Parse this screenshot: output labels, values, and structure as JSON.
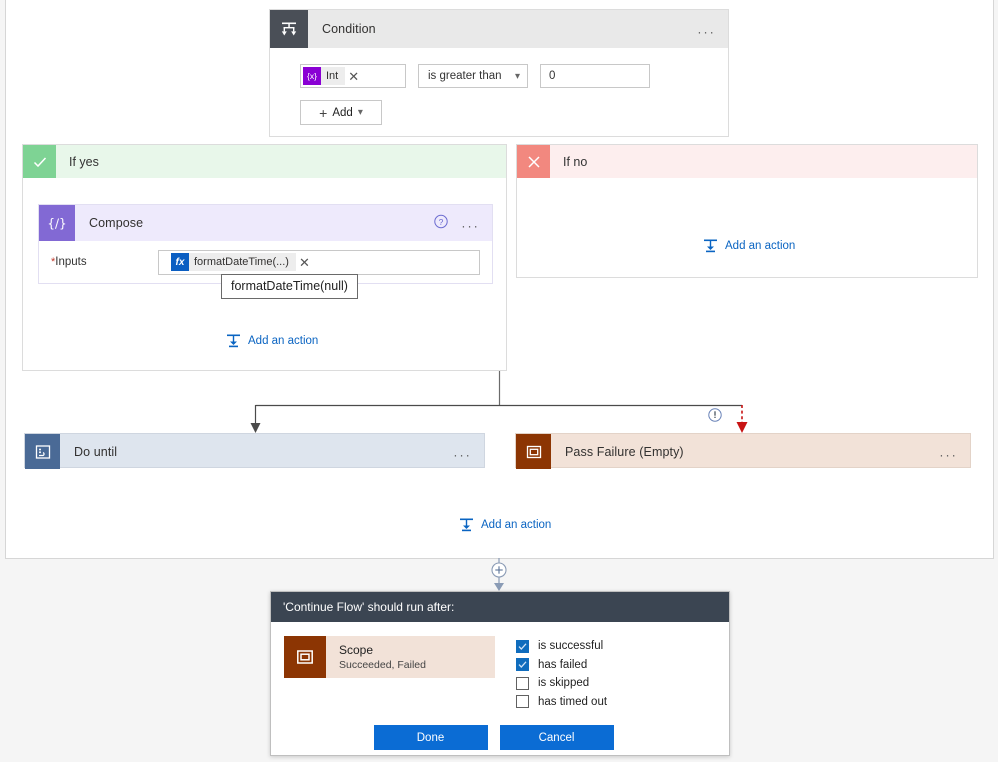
{
  "condition": {
    "title": "Condition",
    "icon": "condition-icon",
    "more_label": "...",
    "left_operand": {
      "token_icon": "{x}",
      "label": "Int",
      "remove_label": "✕"
    },
    "operator": "is greater than",
    "right_operand": "0",
    "add_button": "Add"
  },
  "branch_yes": {
    "label": "If yes",
    "compose": {
      "title": "Compose",
      "help_label": "?",
      "more_label": "...",
      "inputs_label": "Inputs",
      "required_marker": "*",
      "token_icon": "fx",
      "token_label": "formatDateTime(...)",
      "remove_label": "✕"
    },
    "tooltip": "formatDateTime(null)",
    "add_action": "Add an action"
  },
  "branch_no": {
    "label": "If no",
    "add_action": "Add an action"
  },
  "actions": {
    "do_until": {
      "title": "Do until",
      "more_label": "..."
    },
    "pass_failure": {
      "title": "Pass Failure (Empty)",
      "more_label": "..."
    },
    "add_action": "Add an action",
    "info_icon_label": "!"
  },
  "dialog": {
    "title": "'Continue Flow' should run after:",
    "scope": {
      "name": "Scope",
      "status": "Succeeded, Failed"
    },
    "conditions": [
      {
        "label": "is successful",
        "checked": true
      },
      {
        "label": "has failed",
        "checked": true
      },
      {
        "label": "is skipped",
        "checked": false
      },
      {
        "label": "has timed out",
        "checked": false
      }
    ],
    "done_label": "Done",
    "cancel_label": "Cancel"
  },
  "colors": {
    "condition_icon": "#4a4f57",
    "compose_icon": "#8269d4",
    "yes_badge": "#7ed394",
    "no_badge": "#f2887f",
    "do_until_icon": "#4a6a96",
    "pass_failure_icon": "#8c3503",
    "accent_blue": "#0b6cd4",
    "link_blue": "#0a64c2",
    "error_red": "#c81414"
  }
}
